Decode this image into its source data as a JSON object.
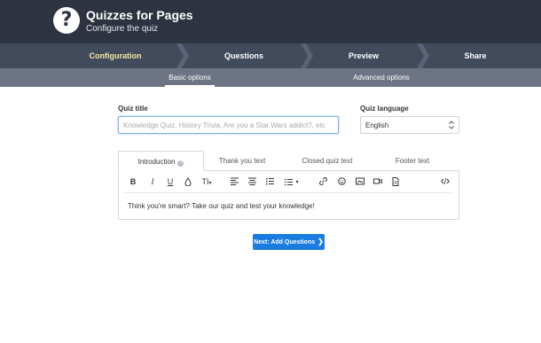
{
  "header": {
    "logo_icon": "question-mark-icon",
    "title": "Quizzes for Pages",
    "subtitle": "Configure the quiz"
  },
  "steps": [
    {
      "label": "Configuration",
      "active": true
    },
    {
      "label": "Questions",
      "active": false
    },
    {
      "label": "Preview",
      "active": false
    },
    {
      "label": "Share",
      "active": false
    }
  ],
  "subtabs": [
    {
      "label": "Basic options",
      "active": true
    },
    {
      "label": "Advanced options",
      "active": false
    }
  ],
  "form": {
    "quiz_title_label": "Quiz title",
    "quiz_title_placeholder": "Knowledge Quiz, History Trivia, Are you a Star Wars addict?, etc",
    "quiz_title_value": "",
    "language_label": "Quiz language",
    "language_value": "English"
  },
  "editor": {
    "tabs": [
      {
        "label": "Introduction",
        "active": true
      },
      {
        "label": "Thank you text",
        "active": false
      },
      {
        "label": "Closed quiz text",
        "active": false
      },
      {
        "label": "Footer text",
        "active": false
      }
    ],
    "toolbar": {
      "bold": "B",
      "italic": "I",
      "underline": "U",
      "text_size": "TI"
    },
    "content": "Think you're smart? Take our quiz and test your knowledge!"
  },
  "next_button": {
    "label": "Next: Add Questions",
    "icon": "chevron-right-icon"
  },
  "colors": {
    "header_bg": "#2d3340",
    "steps_bg": "#414b5c",
    "subtabs_bg": "#6d7585",
    "active_step": "#f5e9a0",
    "primary": "#1a7ce0"
  }
}
